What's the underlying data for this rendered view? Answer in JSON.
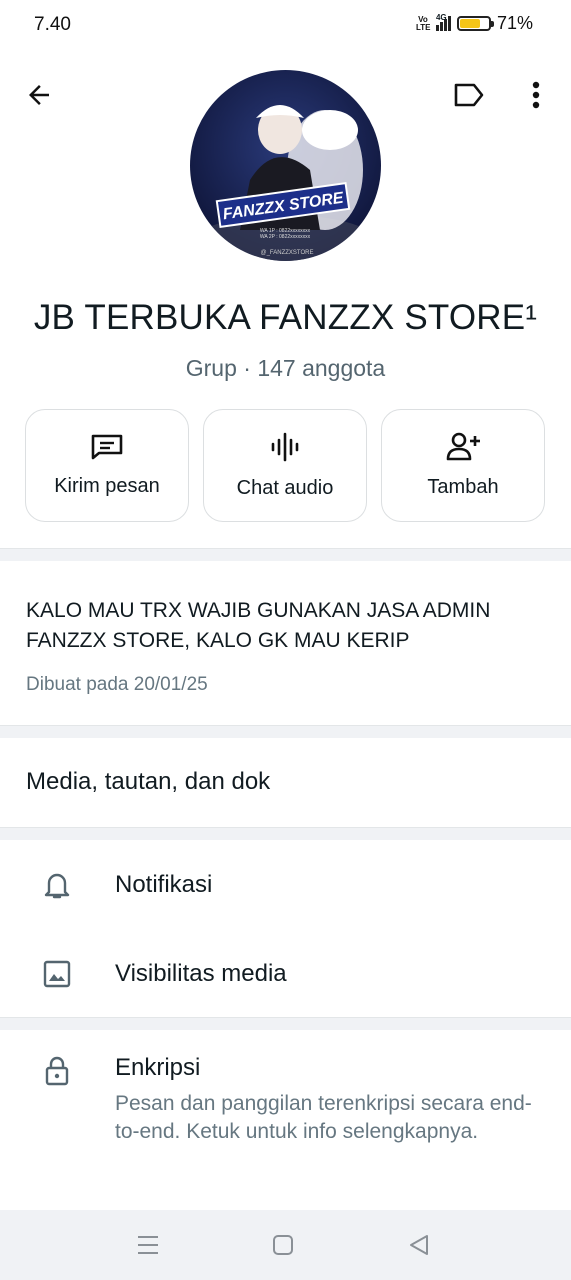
{
  "status": {
    "time": "7.40",
    "volte": "Vo\nLTE",
    "network": "4G",
    "battery_pct": "71%",
    "battery_level": 0.71
  },
  "header": {
    "back_icon": "arrow-left-icon",
    "label_icon": "label-tag-icon",
    "more_icon": "more-vert-icon"
  },
  "group": {
    "name": "JB TERBUKA FANZZX STORE¹",
    "meta": "Grup · 147 anggota",
    "avatar_text": "FANZZX STORE",
    "avatar_subtext": "WA 1P : 0822xxxxxxxx\nWA 2P : 0822xxxxxxxx",
    "avatar_tag": "@_FANZZXSTORE"
  },
  "actions": [
    {
      "label": "Kirim pesan",
      "icon": "message-icon"
    },
    {
      "label": "Chat audio",
      "icon": "audio-wave-icon"
    },
    {
      "label": "Tambah",
      "icon": "add-person-icon"
    }
  ],
  "description": {
    "text": "KALO MAU TRX WAJIB GUNAKAN JASA ADMIN FANZZX STORE, KALO GK MAU KERIP",
    "created": "Dibuat pada 20/01/25"
  },
  "media": {
    "label": "Media, tautan, dan dok"
  },
  "settings": {
    "notifications": "Notifikasi",
    "media_visibility": "Visibilitas media",
    "encryption_title": "Enkripsi",
    "encryption_sub": "Pesan dan panggilan terenkripsi secara end-to-end. Ketuk untuk info selengkapnya."
  },
  "colors": {
    "divider": "#f0f2f5",
    "secondary_text": "#667781",
    "battery": "#f5c518"
  }
}
